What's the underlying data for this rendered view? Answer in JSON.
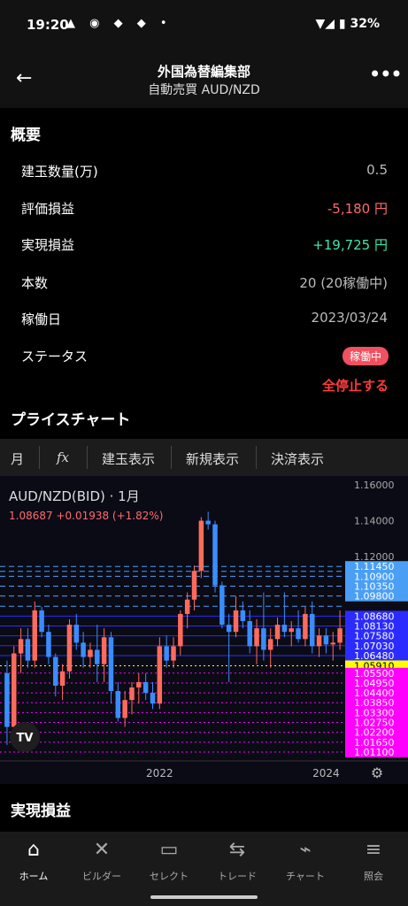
{
  "status_bar": {
    "time": "19:20",
    "icons": "▲ ◉ ◆ ◆ •",
    "battery": "▼◢ ▮ 32%"
  },
  "header": {
    "title": "外国為替編集部",
    "subtitle": "自動売買 AUD/NZD",
    "back_icon": "arrow-left-icon",
    "more_icon": "more-vert-icon"
  },
  "overview": {
    "title": "概要",
    "rows": [
      {
        "label": "建玉数量(万)",
        "value": "0.5"
      },
      {
        "label": "評価損益",
        "value": "-5,180 円"
      },
      {
        "label": "実現損益",
        "value": "+19,725 円"
      },
      {
        "label": "本数",
        "value": "20 (20稼働中)"
      },
      {
        "label": "稼働日",
        "value": "2023/03/24"
      },
      {
        "label": "ステータス",
        "value": ""
      }
    ],
    "status_badge": "稼働中",
    "stop_all": "全停止する"
  },
  "price_chart": {
    "title": "プライスチャート",
    "toolbar": {
      "interval": "月",
      "indicator": "fx",
      "positions": "建玉表示",
      "new_orders": "新規表示",
      "settle": "決済表示"
    }
  },
  "chart_data": {
    "type": "candlestick",
    "title": "AUD/NZD(BID) · 1月",
    "quote": "1.08687  +0.01938 (+1.82%)",
    "ylim": [
      1.01,
      1.16
    ],
    "y_ticks": [
      "1.16000",
      "1.14000",
      "1.12000"
    ],
    "x_ticks": [
      {
        "label": "2022",
        "index": 22
      },
      {
        "label": "2024",
        "index": 46
      }
    ],
    "candles": [
      [
        1.055,
        1.062,
        1.015,
        1.025
      ],
      [
        1.025,
        1.07,
        1.02,
        1.066
      ],
      [
        1.066,
        1.08,
        1.055,
        1.074
      ],
      [
        1.074,
        1.08,
        1.058,
        1.062
      ],
      [
        1.062,
        1.095,
        1.058,
        1.09
      ],
      [
        1.09,
        1.092,
        1.075,
        1.078
      ],
      [
        1.078,
        1.082,
        1.06,
        1.064
      ],
      [
        1.064,
        1.066,
        1.042,
        1.048
      ],
      [
        1.048,
        1.06,
        1.04,
        1.056
      ],
      [
        1.056,
        1.085,
        1.052,
        1.082
      ],
      [
        1.082,
        1.088,
        1.068,
        1.072
      ],
      [
        1.072,
        1.078,
        1.058,
        1.064
      ],
      [
        1.064,
        1.072,
        1.058,
        1.068
      ],
      [
        1.068,
        1.082,
        1.05,
        1.06
      ],
      [
        1.06,
        1.08,
        1.05,
        1.075
      ],
      [
        1.075,
        1.078,
        1.038,
        1.045
      ],
      [
        1.045,
        1.05,
        1.028,
        1.03
      ],
      [
        1.03,
        1.045,
        1.025,
        1.04
      ],
      [
        1.04,
        1.05,
        1.032,
        1.047
      ],
      [
        1.047,
        1.055,
        1.038,
        1.05
      ],
      [
        1.05,
        1.055,
        1.04,
        1.044
      ],
      [
        1.044,
        1.05,
        1.035,
        1.038
      ],
      [
        1.038,
        1.075,
        1.035,
        1.07
      ],
      [
        1.07,
        1.076,
        1.058,
        1.062
      ],
      [
        1.062,
        1.075,
        1.058,
        1.07
      ],
      [
        1.07,
        1.09,
        1.065,
        1.088
      ],
      [
        1.088,
        1.1,
        1.08,
        1.096
      ],
      [
        1.096,
        1.115,
        1.09,
        1.112
      ],
      [
        1.112,
        1.142,
        1.108,
        1.14
      ],
      [
        1.14,
        1.145,
        1.135,
        1.138
      ],
      [
        1.138,
        1.14,
        1.1,
        1.104
      ],
      [
        1.104,
        1.106,
        1.08,
        1.082
      ],
      [
        1.082,
        1.088,
        1.05,
        1.078
      ],
      [
        1.078,
        1.098,
        1.075,
        1.09
      ],
      [
        1.09,
        1.095,
        1.08,
        1.084
      ],
      [
        1.084,
        1.09,
        1.066,
        1.07
      ],
      [
        1.07,
        1.085,
        1.06,
        1.08
      ],
      [
        1.08,
        1.1,
        1.062,
        1.068
      ],
      [
        1.068,
        1.08,
        1.058,
        1.074
      ],
      [
        1.074,
        1.086,
        1.07,
        1.082
      ],
      [
        1.082,
        1.1,
        1.075,
        1.078
      ],
      [
        1.078,
        1.084,
        1.07,
        1.08
      ],
      [
        1.08,
        1.09,
        1.072,
        1.074
      ],
      [
        1.074,
        1.092,
        1.07,
        1.088
      ],
      [
        1.088,
        1.095,
        1.066,
        1.07
      ],
      [
        1.07,
        1.08,
        1.064,
        1.076
      ],
      [
        1.076,
        1.08,
        1.066,
        1.071
      ],
      [
        1.071,
        1.078,
        1.062,
        1.072
      ],
      [
        1.072,
        1.09,
        1.068,
        1.08
      ]
    ],
    "price_levels": [
      {
        "value": 1.1145,
        "label": "1.11450",
        "color": "#4a9ff5",
        "style": "dash"
      },
      {
        "value": 1.11175,
        "label": "",
        "color": "#4a9ff5",
        "style": "dash"
      },
      {
        "value": 1.109,
        "label": "1.10900",
        "color": "#4a9ff5",
        "style": "dash"
      },
      {
        "value": 1.1035,
        "label": "1.10350",
        "color": "#4a9ff5",
        "style": "dash"
      },
      {
        "value": 1.098,
        "label": "1.09800",
        "color": "#4a9ff5",
        "style": "dash"
      },
      {
        "value": 1.0923,
        "label": "",
        "color": "#4a9ff5",
        "style": "dash"
      },
      {
        "value": 1.0868,
        "label": "1.08680",
        "color": "#2b2bff",
        "style": "solid"
      },
      {
        "value": 1.0813,
        "label": "1.08130",
        "color": "#2b2bff",
        "style": "solid"
      },
      {
        "value": 1.0758,
        "label": "1.07580",
        "color": "#2b2bff",
        "style": "solid"
      },
      {
        "value": 1.0703,
        "label": "1.07030",
        "color": "#2b2bff",
        "style": "solid"
      },
      {
        "value": 1.0648,
        "label": "1.06480",
        "color": "#2b2bff",
        "style": "solid"
      },
      {
        "value": 1.0591,
        "label": "1.05910",
        "color": "#ffff00",
        "style": "dot"
      },
      {
        "value": 1.055,
        "label": "1.05500",
        "color": "#ff00ff",
        "style": "dot"
      },
      {
        "value": 1.0495,
        "label": "1.04950",
        "color": "#ff00ff",
        "style": "dot"
      },
      {
        "value": 1.044,
        "label": "1.04400",
        "color": "#ff00ff",
        "style": "dot"
      },
      {
        "value": 1.0385,
        "label": "1.03850",
        "color": "#ff00ff",
        "style": "dot"
      },
      {
        "value": 1.033,
        "label": "1.03300",
        "color": "#ff00ff",
        "style": "dot"
      },
      {
        "value": 1.0275,
        "label": "1.02750",
        "color": "#ff00ff",
        "style": "dot"
      },
      {
        "value": 1.022,
        "label": "1.02200",
        "color": "#ff00ff",
        "style": "dot"
      },
      {
        "value": 1.0165,
        "label": "1.01650",
        "color": "#ff00ff",
        "style": "dot"
      },
      {
        "value": 1.011,
        "label": "1.01100",
        "color": "#ff00ff",
        "style": "dot"
      }
    ],
    "colors": {
      "up": "#ff6b5b",
      "down": "#3a8dff"
    },
    "logo": "TV"
  },
  "realized": {
    "title": "実現損益"
  },
  "bottom_nav": [
    {
      "label": "ホーム",
      "icon": "home-icon",
      "glyph": "⌂",
      "active": true
    },
    {
      "label": "ビルダー",
      "icon": "tools-icon",
      "glyph": "✕",
      "active": false
    },
    {
      "label": "セレクト",
      "icon": "select-icon",
      "glyph": "▭",
      "active": false
    },
    {
      "label": "トレード",
      "icon": "trade-icon",
      "glyph": "⇆",
      "active": false
    },
    {
      "label": "チャート",
      "icon": "chart-icon",
      "glyph": "⌁",
      "active": false
    },
    {
      "label": "照会",
      "icon": "list-icon",
      "glyph": "≡",
      "active": false
    }
  ]
}
